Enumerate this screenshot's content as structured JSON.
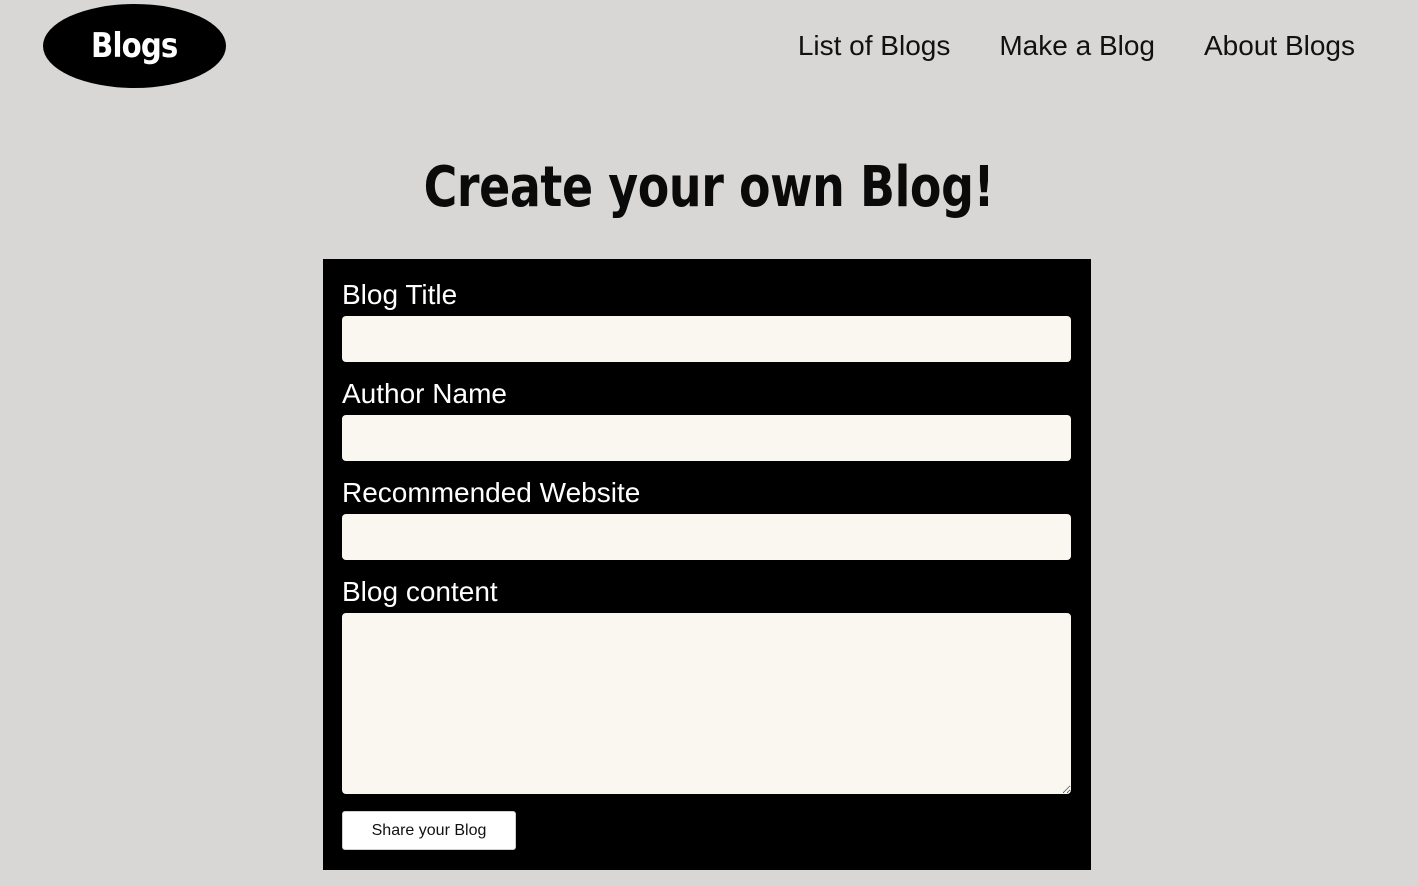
{
  "header": {
    "logo_text": "Blogs",
    "nav": [
      {
        "label": "List of Blogs"
      },
      {
        "label": "Make a Blog"
      },
      {
        "label": "About Blogs"
      }
    ]
  },
  "main": {
    "title": "Create your own Blog!",
    "form": {
      "fields": [
        {
          "label": "Blog Title",
          "value": ""
        },
        {
          "label": "Author Name",
          "value": ""
        },
        {
          "label": "Recommended Website",
          "value": ""
        },
        {
          "label": "Blog content",
          "value": ""
        }
      ],
      "submit_label": "Share your Blog"
    }
  },
  "colors": {
    "page_background": "#d8d7d6",
    "form_background": "#000000",
    "input_background": "#faf7f0",
    "logo_background": "#000000"
  }
}
